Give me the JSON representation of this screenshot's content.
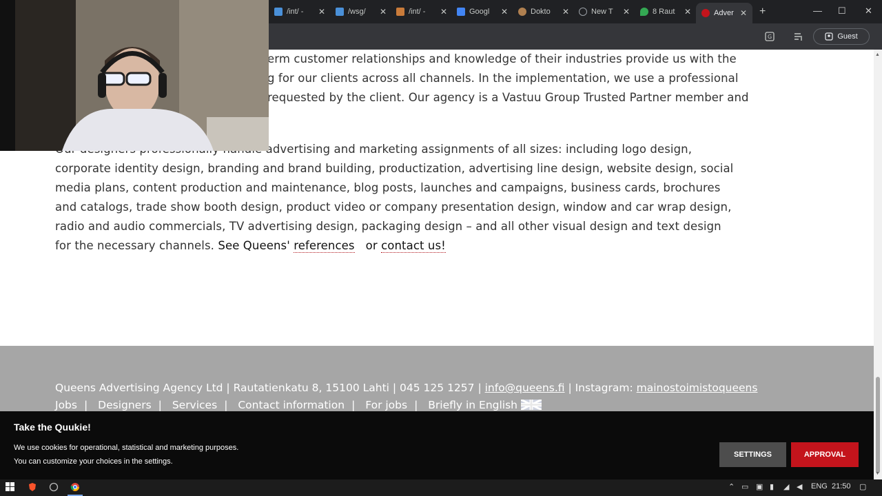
{
  "browser": {
    "tabs": [
      {
        "title": "/int/ -",
        "color": "#4a90d9"
      },
      {
        "title": "/wsg/",
        "color": "#4a90d9"
      },
      {
        "title": "/int/ -",
        "color": "#c97b3a"
      },
      {
        "title": "Googl",
        "color": "#4285f4"
      },
      {
        "title": "Dokto",
        "color": "#b08050"
      },
      {
        "title": "New T",
        "color": "#9aa0a6"
      },
      {
        "title": "8 Raut",
        "color": "#34a853"
      },
      {
        "title": "Adver",
        "color": "#c4141c"
      }
    ],
    "new_tab_icon": "plus-icon",
    "profile_label": "Guest"
  },
  "content": {
    "para1_lines": [
      "erm customer relationships and knowledge of their industries provide us with the",
      "g for our clients across all channels. In the implementation, we use a professional",
      " requested by the client. Our agency is a Vastuu Group Trusted Partner member and"
    ],
    "para2_text": "Our designers professionally handle advertising and marketing assignments of all sizes: including logo design, corporate identity design, branding and brand building, productization, advertising line design, website design, social media plans, content production and maintenance, blog posts, launches and campaigns, business cards, brochures and catalogs, trade show booth design, product video or company presentation design, window and car wrap design, radio and audio commercials, TV advertising design, packaging design – and all other visual design and text design for the necessary channels.",
    "see_prefix": "See Queens'",
    "references_link": "references",
    "or_text": "or",
    "contact_link": "contact us!"
  },
  "footer": {
    "company": "Queens Advertising Agency Ltd | Rautatienkatu 8, 15100 Lahti | 045 125 1257 |",
    "email": "info@queens.fi",
    "instagram_label": "| Instagram:",
    "instagram_handle": "mainostoimistoqueens",
    "links": [
      "Jobs",
      "Designers",
      "Services",
      "Contact information",
      "For jobs",
      "Briefly in English"
    ]
  },
  "cookie": {
    "title": "Take the Quukie!",
    "line1": "We use cookies for operational, statistical and marketing purposes.",
    "line2": "You can customize your choices in the settings.",
    "settings_label": "SETTINGS",
    "approval_label": "APPROVAL"
  },
  "taskbar": {
    "language": "ENG",
    "time": "21:50"
  }
}
